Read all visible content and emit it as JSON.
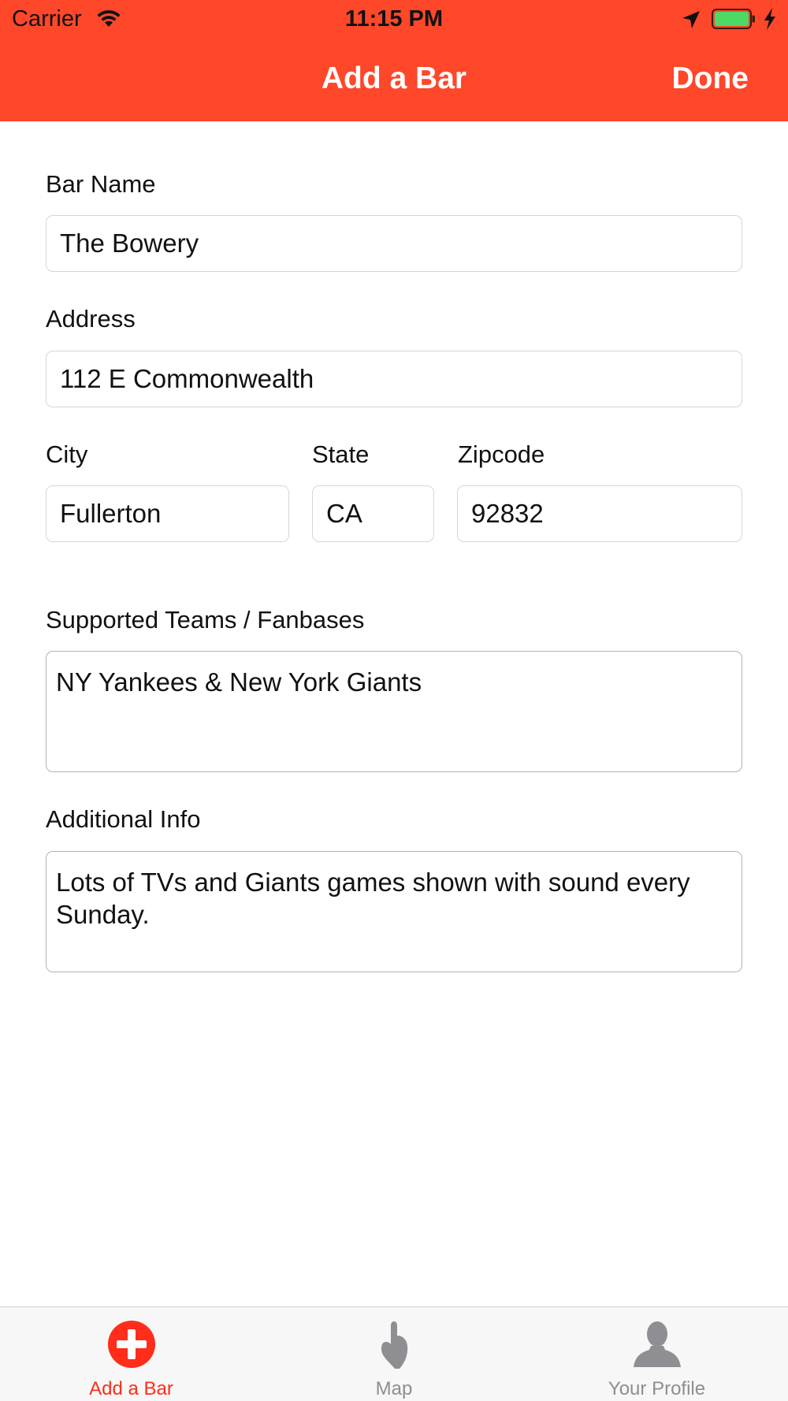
{
  "status_bar": {
    "carrier": "Carrier",
    "time": "11:15 PM"
  },
  "nav": {
    "title": "Add a Bar",
    "done_label": "Done"
  },
  "form": {
    "bar_name": {
      "label": "Bar Name",
      "value": "The Bowery"
    },
    "address": {
      "label": "Address",
      "value": "112 E Commonwealth"
    },
    "city": {
      "label": "City",
      "value": "Fullerton"
    },
    "state": {
      "label": "State",
      "value": "CA"
    },
    "zipcode": {
      "label": "Zipcode",
      "value": "92832"
    },
    "teams": {
      "label": "Supported Teams / Fanbases",
      "value": "NY Yankees & New York Giants"
    },
    "info": {
      "label": "Additional Info",
      "value": "Lots of TVs and Giants games shown with sound every Sunday."
    }
  },
  "tab_bar": {
    "tabs": [
      {
        "label": "Add a Bar",
        "icon": "plus-circle-icon",
        "active": true
      },
      {
        "label": "Map",
        "icon": "pointing-hand-icon",
        "active": false
      },
      {
        "label": "Your Profile",
        "icon": "person-icon",
        "active": false
      }
    ]
  },
  "colors": {
    "header": "#ff472a",
    "accent": "#ff2d1a",
    "inactive": "#8e8e93"
  }
}
